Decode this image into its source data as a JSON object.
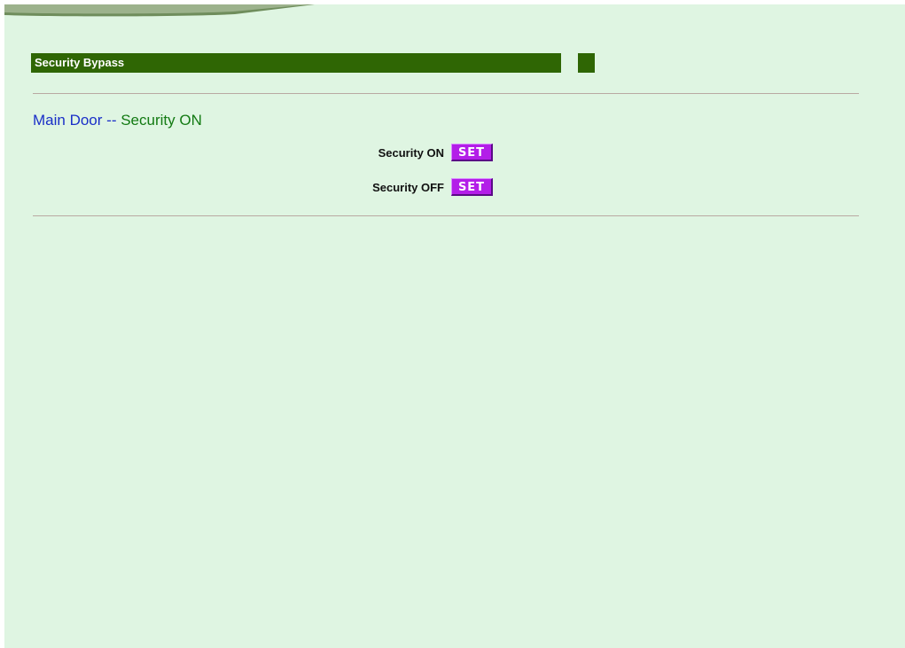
{
  "page": {
    "background_color": "#dff5e2"
  },
  "header": {
    "title": "Security Bypass",
    "bar_color": "#2f6604"
  },
  "door": {
    "name": "Main Door",
    "separator": "--",
    "state": "Security ON"
  },
  "actions": [
    {
      "label": "Security ON",
      "button_label": "SET"
    },
    {
      "label": "Security OFF",
      "button_label": "SET"
    }
  ],
  "colors": {
    "door_name": "#1a2fc8",
    "door_state": "#137a13",
    "set_button": "#b31ee8"
  }
}
